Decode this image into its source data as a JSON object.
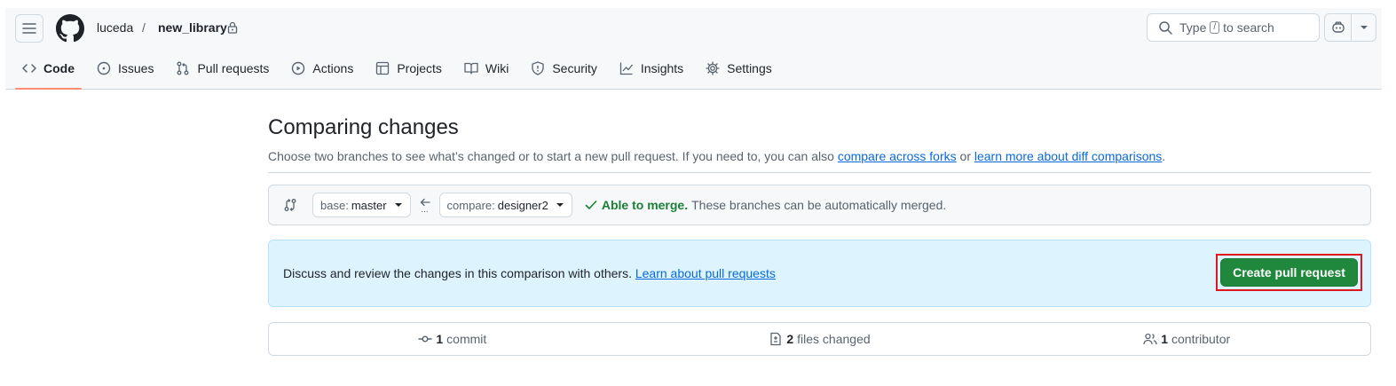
{
  "header": {
    "owner": "luceda",
    "separator": "/",
    "repo": "new_library",
    "search_prefix": "Type",
    "search_key": "/",
    "search_suffix": "to search"
  },
  "tabs": [
    {
      "label": "Code",
      "icon": "code-icon",
      "selected": true
    },
    {
      "label": "Issues",
      "icon": "issue-opened-icon",
      "selected": false
    },
    {
      "label": "Pull requests",
      "icon": "git-pull-request-icon",
      "selected": false
    },
    {
      "label": "Actions",
      "icon": "play-icon",
      "selected": false
    },
    {
      "label": "Projects",
      "icon": "table-icon",
      "selected": false
    },
    {
      "label": "Wiki",
      "icon": "book-icon",
      "selected": false
    },
    {
      "label": "Security",
      "icon": "shield-icon",
      "selected": false
    },
    {
      "label": "Insights",
      "icon": "graph-icon",
      "selected": false
    },
    {
      "label": "Settings",
      "icon": "gear-icon",
      "selected": false
    }
  ],
  "main": {
    "title": "Comparing changes",
    "subtitle_text": "Choose two branches to see what’s changed or to start a new pull request. If you need to, you can also",
    "link_forks": "compare across forks",
    "subtitle_or": "or",
    "link_learn": "learn more about diff comparisons",
    "subtitle_end": "."
  },
  "range": {
    "base_prefix": "base:",
    "base_branch": "master",
    "compare_prefix": "compare:",
    "compare_branch": "designer2",
    "merge_status": "Able to merge.",
    "merge_detail": "These branches can be automatically merged."
  },
  "info": {
    "text": "Discuss and review the changes in this comparison with others.",
    "link": "Learn about pull requests",
    "button": "Create pull request"
  },
  "stats": {
    "commits_count": "1",
    "commits_label": "commit",
    "files_count": "2",
    "files_label": "files changed",
    "contributors_count": "1",
    "contributors_label": "contributor"
  },
  "colors": {
    "accent_blue": "#0969da",
    "success_green": "#1a7f37",
    "button_green": "#1f883d",
    "tab_underline": "#fd8c73",
    "highlight_red": "#e0161c",
    "info_bg": "#ddf4ff"
  }
}
